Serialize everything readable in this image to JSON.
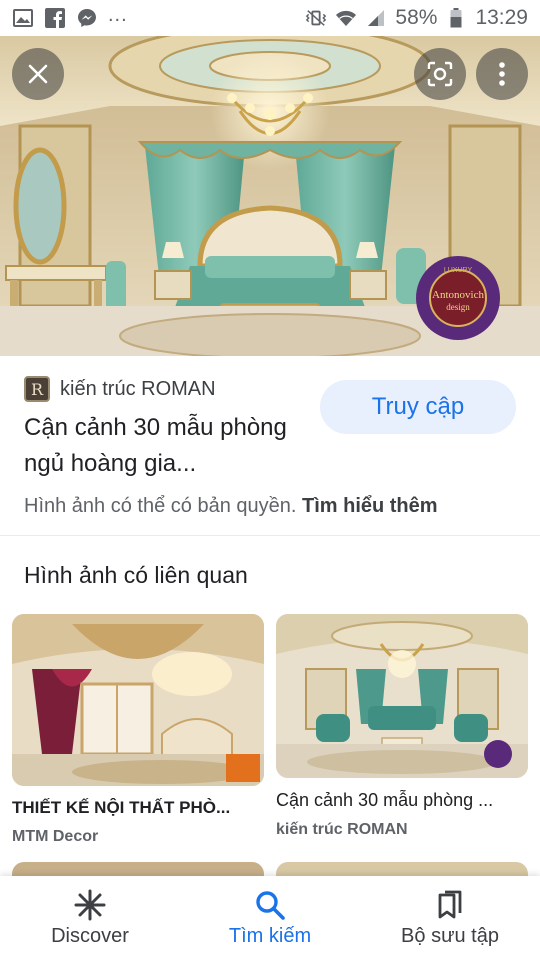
{
  "status_bar": {
    "more": "...",
    "battery": "58%",
    "time": "13:29"
  },
  "hero": {
    "close_icon": "close-icon",
    "lens_icon": "lens-icon",
    "more_icon": "more-vert-icon",
    "watermark_top": "LUXURY",
    "watermark_brand": "Antonovich",
    "watermark_sub": "design"
  },
  "result": {
    "favicon_letter": "R",
    "source": "kiến trúc ROMAN",
    "title": "Cận cảnh 30 mẫu phòng ngủ hoàng gia...",
    "visit_label": "Truy cập",
    "copyright_text": "Hình ảnh có thể có bản quyền.",
    "learn_more": "Tìm hiểu thêm"
  },
  "related": {
    "heading": "Hình ảnh có liên quan",
    "items": [
      {
        "title": "THIẾT KẾ NỘI THẤT PHÒ...",
        "source": "MTM Decor"
      },
      {
        "title": "Cận cảnh 30 mẫu phòng ...",
        "source": "kiến trúc ROMAN"
      }
    ]
  },
  "bottom_nav": {
    "items": [
      {
        "label": "Discover",
        "icon": "asterisk-icon"
      },
      {
        "label": "Tìm kiếm",
        "icon": "search-icon",
        "active": true
      },
      {
        "label": "Bộ sưu tập",
        "icon": "collections-icon"
      }
    ]
  },
  "colors": {
    "accent": "#1a73e8",
    "button_bg": "#e8f0fe"
  }
}
